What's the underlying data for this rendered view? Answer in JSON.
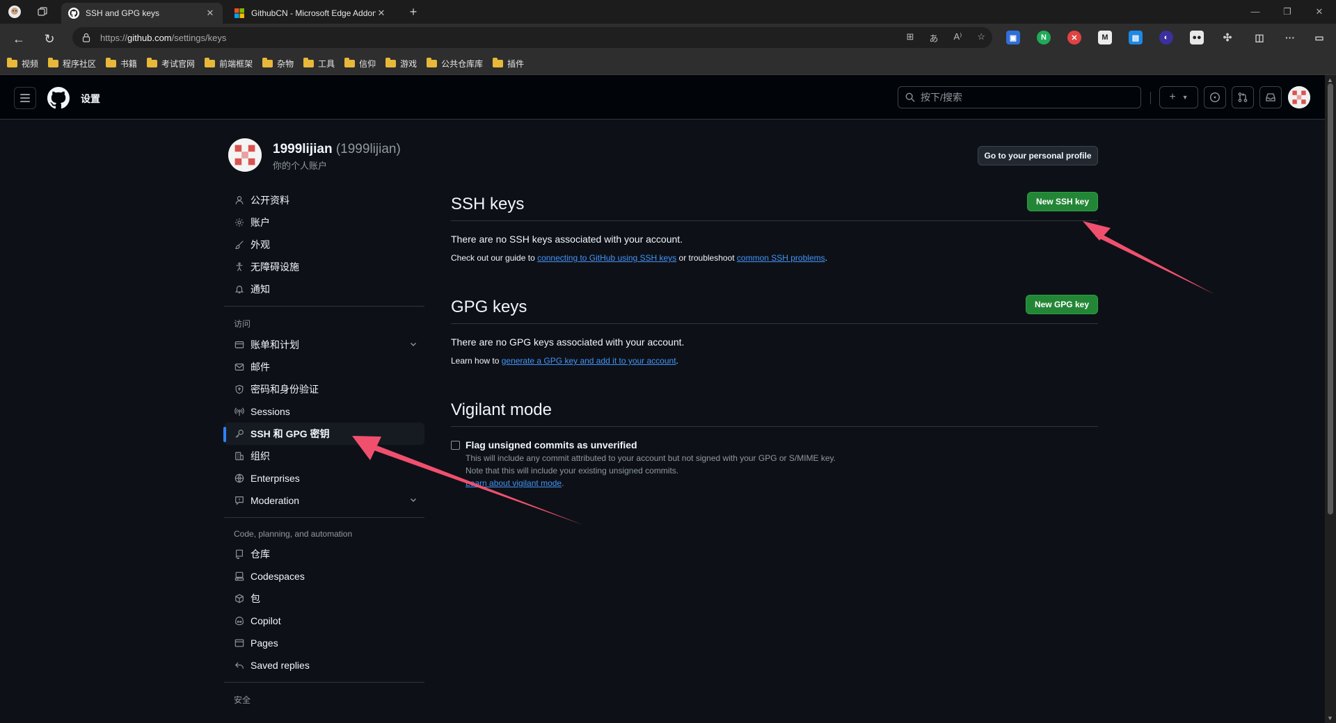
{
  "browser": {
    "tabs": [
      {
        "title": "SSH and GPG keys",
        "active": true
      },
      {
        "title": "GithubCN - Microsoft Edge Addons",
        "active": false
      }
    ],
    "url_prefix": "https://",
    "url_host": "github.com",
    "url_path": "/settings/keys",
    "bookmarks": [
      "视频",
      "程序社区",
      "书籍",
      "考试官网",
      "前端框架",
      "杂物",
      "工具",
      "信仰",
      "游戏",
      "公共仓库库",
      "插件"
    ]
  },
  "header": {
    "context": "设置",
    "search_placeholder": "按下/搜索"
  },
  "user": {
    "display_name": "1999lijian",
    "login": "(1999lijian)",
    "subtitle": "你的个人账户",
    "profile_button": "Go to your personal profile"
  },
  "sidebar": {
    "group1": [
      "公开资料",
      "账户",
      "外观",
      "无障碍设施",
      "通知"
    ],
    "access_heading": "访问",
    "group2": [
      "账单和计划",
      "邮件",
      "密码和身份验证",
      "Sessions",
      "SSH 和 GPG 密钥",
      "组织",
      "Enterprises",
      "Moderation"
    ],
    "code_heading": "Code, planning, and automation",
    "group3": [
      "仓库",
      "Codespaces",
      "包",
      "Copilot",
      "Pages",
      "Saved replies"
    ],
    "security_heading": "安全"
  },
  "ssh": {
    "title": "SSH keys",
    "button": "New SSH key",
    "empty": "There are no SSH keys associated with your account.",
    "guide_pre": "Check out our guide to ",
    "guide_link": "connecting to GitHub using SSH keys",
    "guide_mid": " or troubleshoot ",
    "guide_link2": "common SSH problems",
    "guide_post": "."
  },
  "gpg": {
    "title": "GPG keys",
    "button": "New GPG key",
    "empty": "There are no GPG keys associated with your account.",
    "learn_pre": "Learn how to ",
    "learn_link": "generate a GPG key and add it to your account",
    "learn_post": "."
  },
  "vigilant": {
    "title": "Vigilant mode",
    "checkbox_label": "Flag unsigned commits as unverified",
    "note1": "This will include any commit attributed to your account but not signed with your GPG or S/MIME key.",
    "note2": "Note that this will include your existing unsigned commits.",
    "note_link": "Learn about vigilant mode",
    "note_post": "."
  },
  "colors": {
    "bg": "#0d1117",
    "header_bg": "#010409",
    "accent_green": "#238636",
    "link": "#4493f8",
    "annotation_arrow": "#f0506e"
  }
}
